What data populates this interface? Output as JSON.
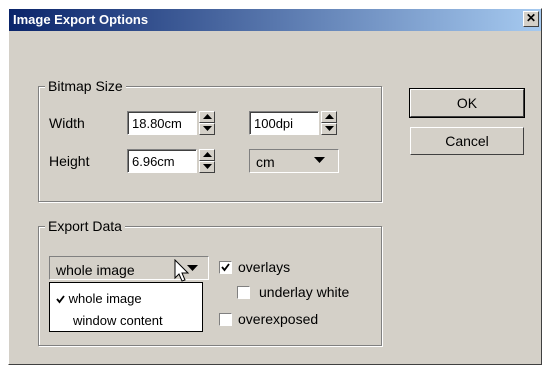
{
  "window": {
    "title": "Image Export Options",
    "close_glyph": "✕"
  },
  "bitmap_size": {
    "legend": "Bitmap Size",
    "width_label": "Width",
    "height_label": "Height",
    "width_value": "18.80cm",
    "height_value": "6.96cm",
    "resolution_value": "100dpi",
    "unit_value": "cm"
  },
  "buttons": {
    "ok": "OK",
    "cancel": "Cancel"
  },
  "export_data": {
    "legend": "Export Data",
    "mode_selected": "whole image",
    "mode_options": [
      {
        "label": "whole image",
        "checked": true
      },
      {
        "label": "window content",
        "checked": false
      }
    ],
    "overlays": {
      "label": "overlays",
      "checked": true
    },
    "underlay_white": {
      "label": "underlay white",
      "checked": false
    },
    "overexposed": {
      "label": "overexposed",
      "checked": false
    }
  },
  "icons": {
    "close": "close-icon",
    "up": "spin-up-icon",
    "down": "spin-down-icon",
    "dropdown": "chevron-down-icon",
    "cursor": "mouse-pointer-icon",
    "check": "check-icon"
  },
  "colors": {
    "dialog_bg": "#d4d0c8",
    "title_start": "#0a246a",
    "title_end": "#a6caf0"
  }
}
